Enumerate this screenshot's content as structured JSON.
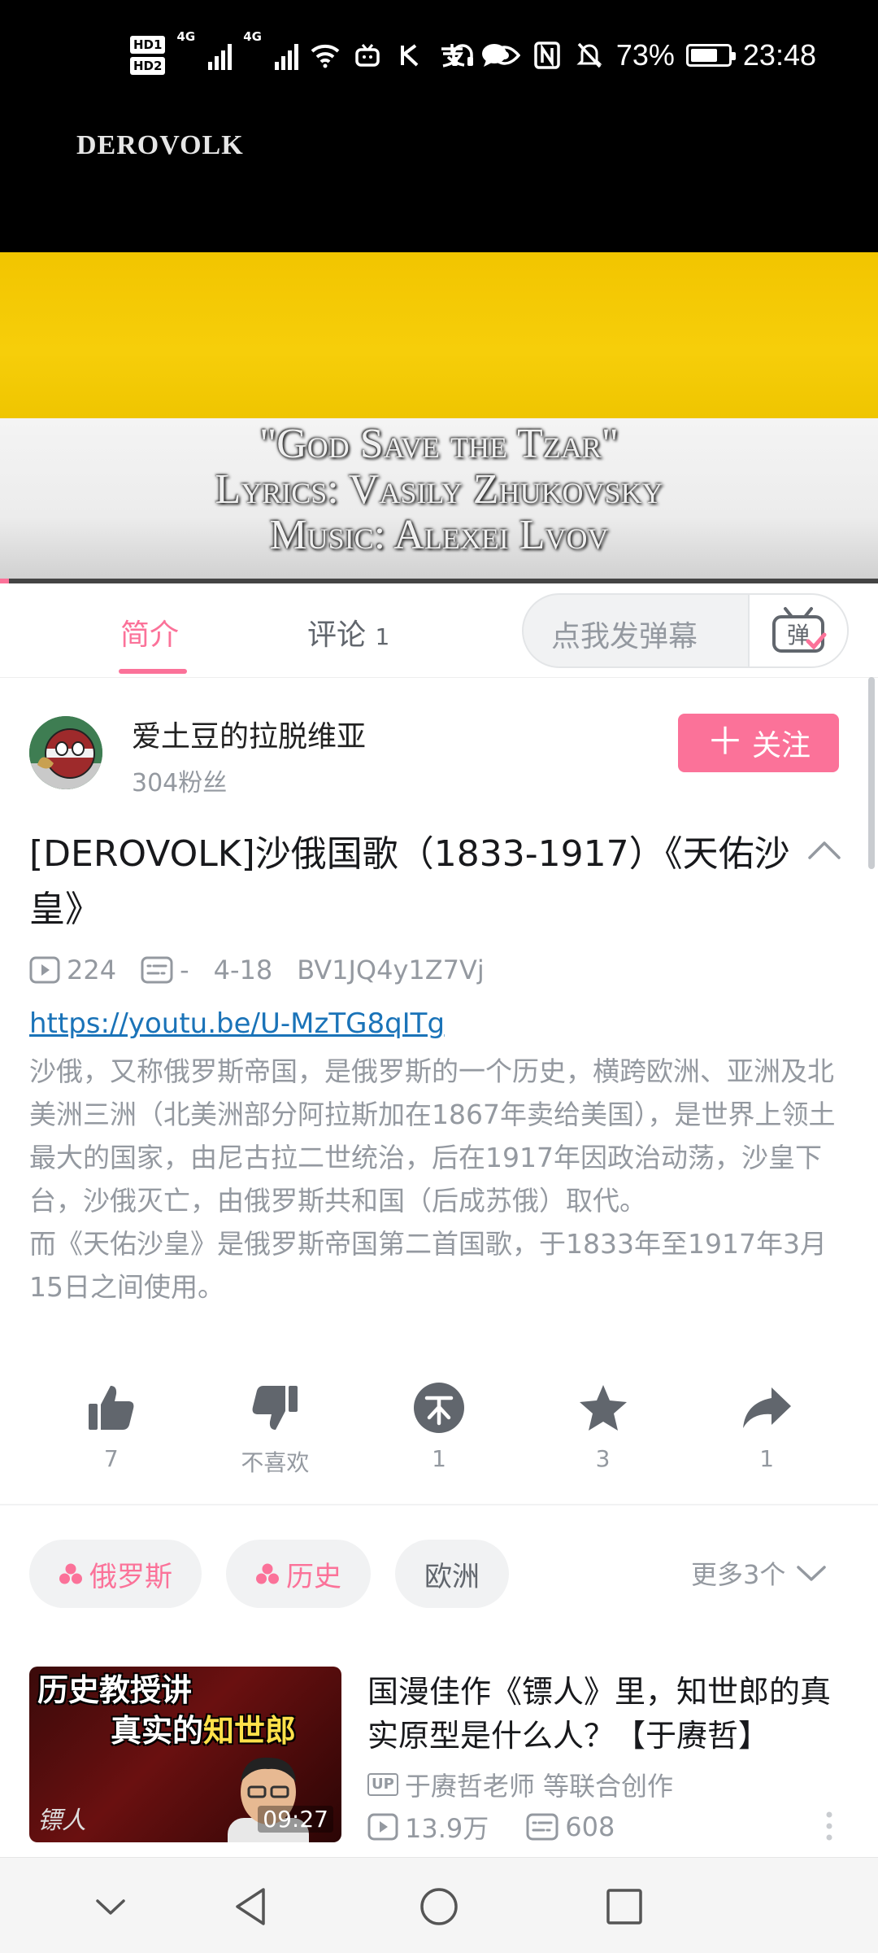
{
  "status_bar": {
    "hd1": "HD1",
    "hd2": "HD2",
    "net1": "4G",
    "net2": "4G",
    "battery_percent": "73%",
    "battery_level": 0.73,
    "time": "23:48",
    "icons": [
      "wifi-icon",
      "tv-icon",
      "kuaishou-icon",
      "alipay-icon",
      "chat-icon",
      "headset-icon",
      "eye-icon",
      "nfc-icon",
      "mute-icon"
    ]
  },
  "video": {
    "watermark": "DEROVOLK",
    "credit_lines": [
      "\"God Save the Tzar\"",
      "Lyrics: Vasily Zhukovsky",
      "Music: Alexei Lvov"
    ],
    "progress": 0.01,
    "flag_colors": [
      "#000000",
      "#f6ce0a",
      "#f0f0f0"
    ]
  },
  "tabs": {
    "intro": "简介",
    "comments_label": "评论",
    "comments_count": "1",
    "danmaku_placeholder": "点我发弹幕",
    "danmaku_button": "弹"
  },
  "uploader": {
    "name": "爱土豆的拉脱维亚",
    "fans": "304粉丝",
    "follow_label": "关注"
  },
  "title": "[DEROVOLK]沙俄国歌（1833-1917）《天佑沙皇》",
  "meta": {
    "views": "224",
    "danmaku": "-",
    "date": "4-18",
    "bvid": "BV1JQ4y1Z7Vj"
  },
  "description": {
    "link": "https://youtu.be/U-MzTG8qITg",
    "text": "沙俄，又称俄罗斯帝国，是俄罗斯的一个历史，横跨欧洲、亚洲及北美洲三洲（北美洲部分阿拉斯加在1867年卖给美国），是世界上领土最大的国家，由尼古拉二世统治，后在1917年因政治动荡，沙皇下台，沙俄灭亡，由俄罗斯共和国（后成苏俄）取代。\n而《天佑沙皇》是俄罗斯帝国第二首国歌，于1833年至1917年3月15日之间使用。"
  },
  "actions": {
    "like": "7",
    "dislike": "不喜欢",
    "coin": "1",
    "favorite": "3",
    "share": "1"
  },
  "tags": {
    "items": [
      {
        "label": "俄罗斯",
        "hot": true
      },
      {
        "label": "历史",
        "hot": true
      },
      {
        "label": "欧洲",
        "hot": false
      }
    ],
    "more": "更多3个"
  },
  "related": {
    "thumb_caption_line1": "历史教授讲",
    "thumb_caption_line2_a": "真实的",
    "thumb_caption_line2_b": "知世郎",
    "thumb_mark": "镖人",
    "duration": "09:27",
    "title": "国漫佳作《镖人》里，知世郎的真实原型是什么人？【于赓哲】",
    "up_badge": "UP",
    "author": "于赓哲老师 等联合创作",
    "views": "13.9万",
    "danmaku": "608"
  },
  "colors": {
    "accent": "#fb7299",
    "link": "#1a73b8",
    "muted": "#9499a0"
  }
}
